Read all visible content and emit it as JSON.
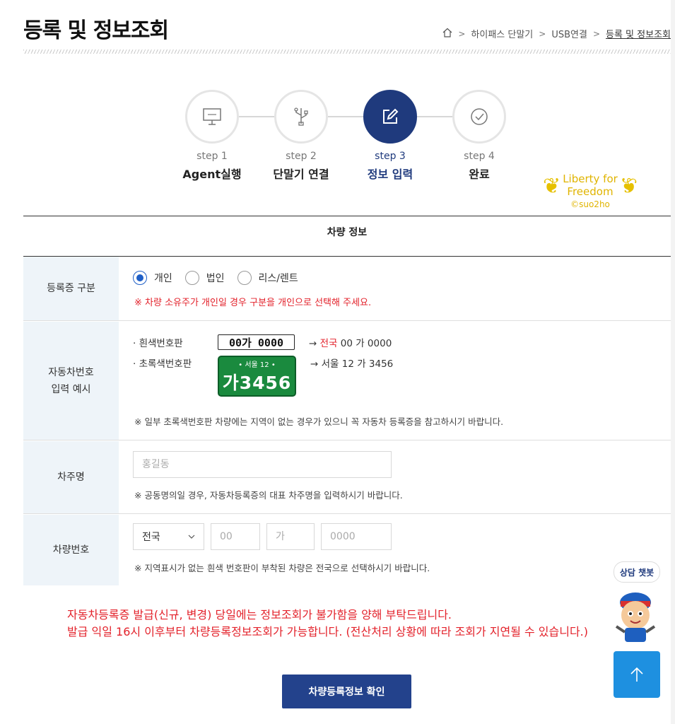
{
  "header": {
    "title": "등록 및 정보조회",
    "breadcrumb": [
      "하이패스 단말기",
      "USB연결",
      "등록 및 정보조회"
    ]
  },
  "steps": [
    {
      "num": "step 1",
      "label": "Agent실행",
      "icon": "monitor-icon",
      "active": false
    },
    {
      "num": "step 2",
      "label": "단말기 연결",
      "icon": "usb-icon",
      "active": false
    },
    {
      "num": "step 3",
      "label": "정보 입력",
      "icon": "edit-icon",
      "active": true
    },
    {
      "num": "step 4",
      "label": "완료",
      "icon": "check-icon",
      "active": false
    }
  ],
  "stamp": {
    "line1": "Liberty for",
    "line2": "Freedom",
    "line3": "©suo2ho"
  },
  "form": {
    "section_title": "차량 정보",
    "registration_type": {
      "label": "등록증 구분",
      "options": [
        "개인",
        "법인",
        "리스/렌트"
      ],
      "selected": "개인",
      "note": "※ 차량 소유주가 개인일 경우 구분을 개인으로 선택해 주세요."
    },
    "plate_example": {
      "label_line1": "자동차번호",
      "label_line2": "입력 예시",
      "white_label": "흰색번호판",
      "white_plate": "00가 0000",
      "white_arrow": "→",
      "white_region": "전국",
      "white_result": "00 가 0000",
      "green_label": "초록색번호판",
      "green_plate_top": "• 서울 12 •",
      "green_plate_bottom": "가3456",
      "green_result": "→ 서울 12 가 3456",
      "note": "※ 일부 초록색번호판 차량에는 지역이 없는 경우가 있으니 꼭 자동차 등록증을 참고하시기 바랍니다."
    },
    "owner": {
      "label": "차주명",
      "placeholder": "홍길동",
      "note": "※ 공동명의일 경우, 자동차등록증의 대표 차주명을 입력하시기 바랍니다."
    },
    "vehicle_number": {
      "label": "차량번호",
      "region_selected": "전국",
      "placeholder_num1": "00",
      "placeholder_char": "가",
      "placeholder_num2": "0000",
      "note": "※ 지역표시가 없는 흰색 번호판이 부착된 차량은 전국으로 선택하시기 바랍니다."
    }
  },
  "notice": {
    "line1": "자동차등록증 발급(신규, 변경) 당일에는 정보조회가 불가함을 양해 부탁드립니다.",
    "line2": "발급 익일 16시 이후부터 차량등록정보조회가 가능합니다. (전산처리 상황에 따라 조회가 지연될 수 있습니다.)"
  },
  "submit_label": "차량등록정보 확인",
  "chatbot_label": "상담 챗봇",
  "colors": {
    "primary": "#1f3a7d",
    "accent": "#1e90e0",
    "red": "#e3222b",
    "label_bg": "#eef4f9"
  }
}
